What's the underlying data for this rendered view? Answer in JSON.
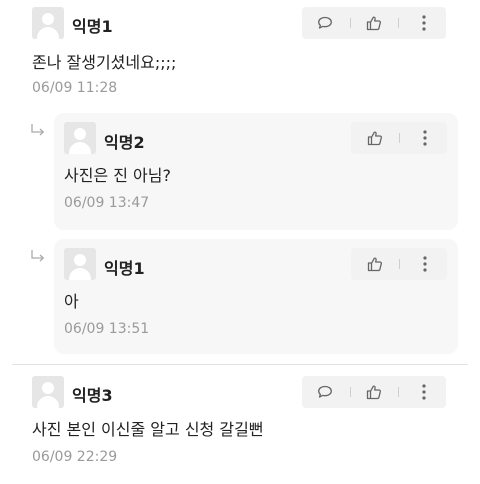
{
  "comments": [
    {
      "author": "익명1",
      "text": "존나 잘생기셨네요;;;;",
      "time": "06/09 11:28"
    },
    {
      "author": "익명3",
      "text": "사진 본인 이신줄 알고 신청 갈길뻔",
      "time": "06/09 22:29"
    }
  ],
  "replies": [
    {
      "author": "익명2",
      "text": "사진은 진 아님?",
      "time": "06/09 13:47"
    },
    {
      "author": "익명1",
      "text": "아",
      "time": "06/09 13:51"
    }
  ],
  "icons": {
    "comment": "speech-bubble-icon",
    "like": "thumbs-up-icon",
    "more": "vertical-ellipsis-icon",
    "reply": "reply-arrow-icon",
    "avatar": "default-avatar"
  },
  "colors": {
    "actions_bg": "#f2f2f2",
    "reply_bg": "#f7f7f7",
    "time": "#9a9a9a"
  }
}
